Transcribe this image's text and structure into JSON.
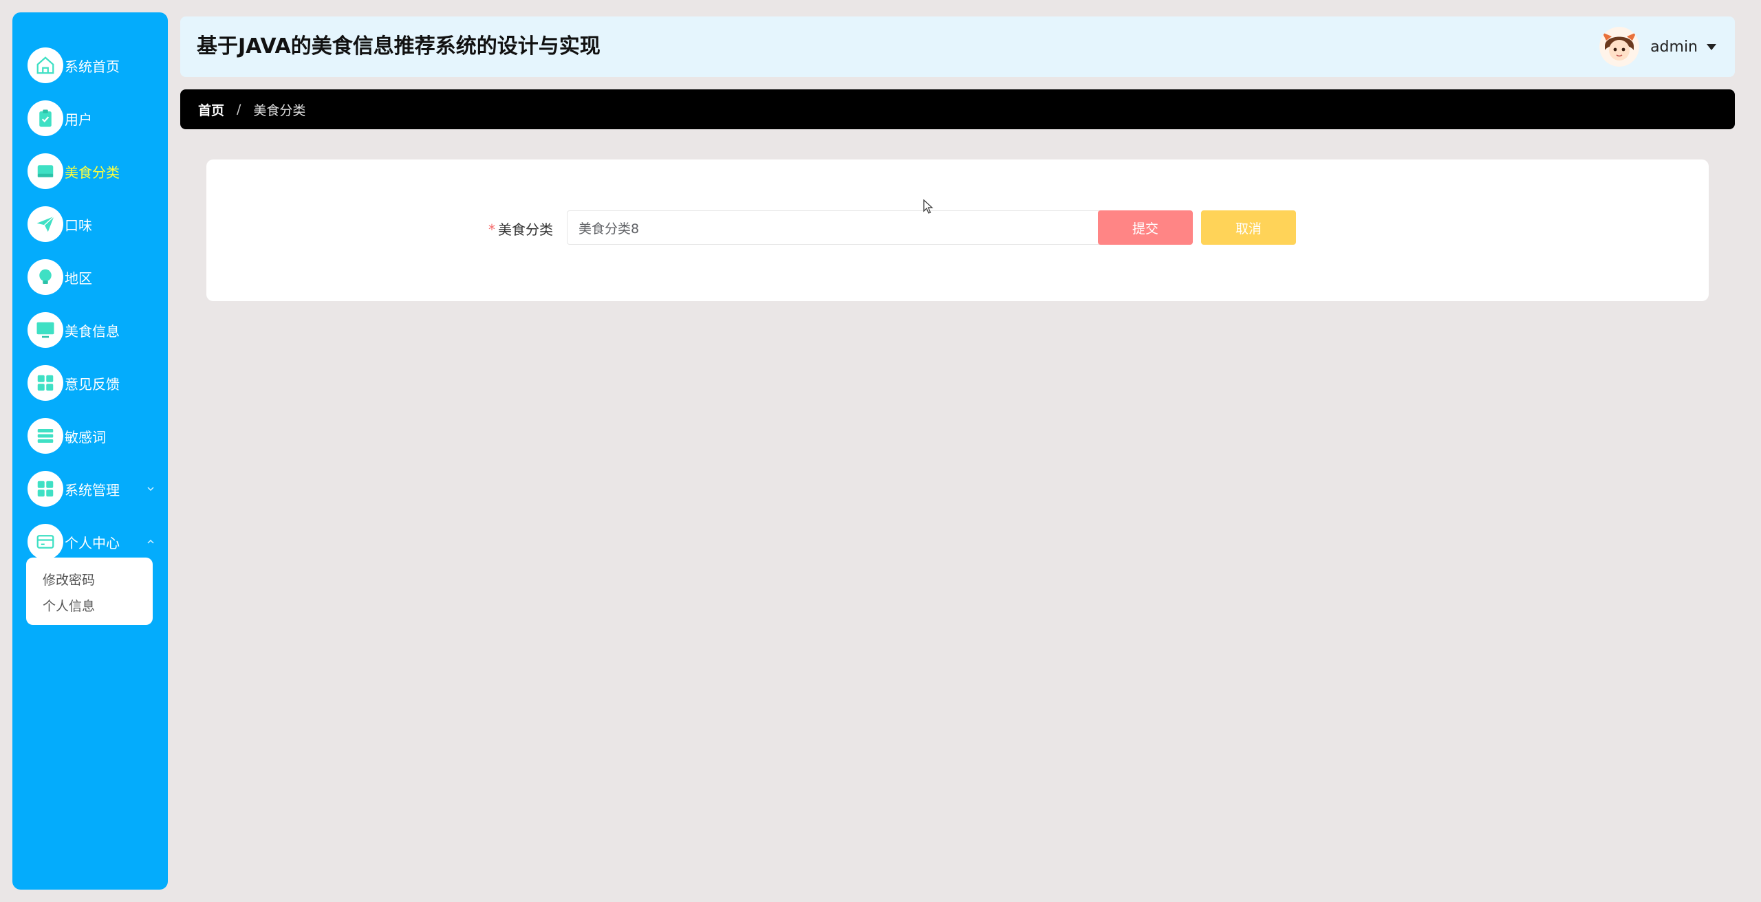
{
  "header": {
    "title": "基于JAVA的美食信息推荐系统的设计与实现",
    "username": "admin",
    "avatar_icon": "avatar-icon",
    "caret_icon": "caret-down-icon"
  },
  "sidebar": {
    "items": [
      {
        "label": "系统首页",
        "icon": "home-icon"
      },
      {
        "label": "用户",
        "icon": "clipboard-icon"
      },
      {
        "label": "美食分类",
        "icon": "drawer-icon",
        "active": true
      },
      {
        "label": "口味",
        "icon": "paper-plane-icon"
      },
      {
        "label": "地区",
        "icon": "bulb-icon"
      },
      {
        "label": "美食信息",
        "icon": "monitor-icon"
      },
      {
        "label": "意见反馈",
        "icon": "grid-icon"
      },
      {
        "label": "敏感词",
        "icon": "list-icon"
      },
      {
        "label": "系统管理",
        "icon": "grid-icon",
        "expandable": true,
        "expanded": false
      },
      {
        "label": "个人中心",
        "icon": "card-icon",
        "expandable": true,
        "expanded": true
      }
    ],
    "submenu": [
      {
        "label": "修改密码"
      },
      {
        "label": "个人信息"
      }
    ]
  },
  "breadcrumb": {
    "home": "首页",
    "separator": "/",
    "current": "美食分类"
  },
  "form": {
    "required_mark": "*",
    "field_label": "美食分类",
    "field_value": "美食分类8",
    "submit_label": "提交",
    "cancel_label": "取消"
  },
  "colors": {
    "sidebar_bg": "#04acfc",
    "active_text": "#ffff3c",
    "icon_color": "#3ee0c4",
    "header_bg": "#e5f5fd",
    "breadcrumb_bg": "#000000",
    "submit_bg": "#ff8585",
    "cancel_bg": "#ffd358",
    "page_bg": "#eae6e6"
  }
}
